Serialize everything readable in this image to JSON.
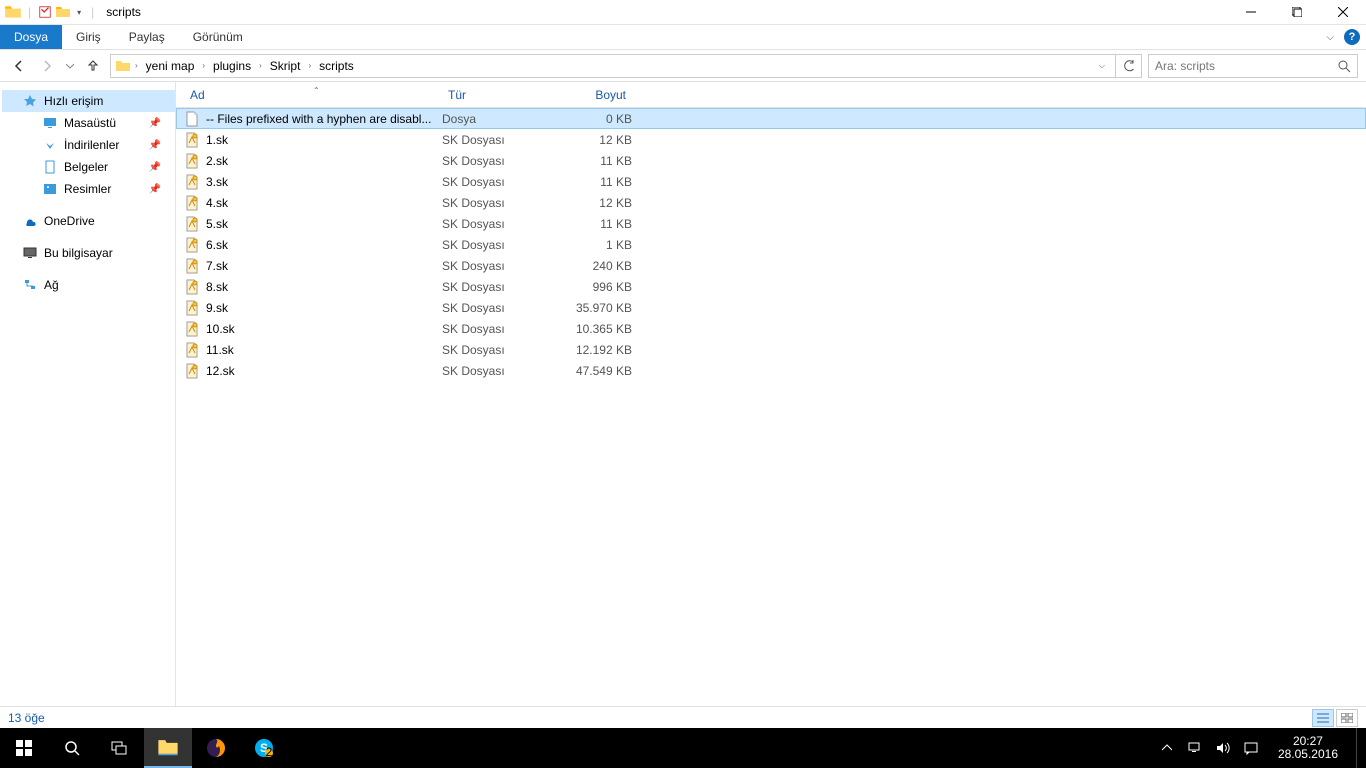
{
  "window": {
    "title": "scripts",
    "controls": {
      "min": "—",
      "max": "▢",
      "close": "✕"
    }
  },
  "ribbon": {
    "file": "Dosya",
    "tabs": [
      "Giriş",
      "Paylaş",
      "Görünüm"
    ]
  },
  "breadcrumb": [
    "yeni map",
    "plugins",
    "Skript",
    "scripts"
  ],
  "search": {
    "placeholder": "Ara: scripts"
  },
  "sidebar": {
    "quick": {
      "label": "Hızlı erişim",
      "items": [
        {
          "label": "Masaüstü",
          "icon": "desktop",
          "pin": true
        },
        {
          "label": "İndirilenler",
          "icon": "download",
          "pin": true
        },
        {
          "label": "Belgeler",
          "icon": "document",
          "pin": true
        },
        {
          "label": "Resimler",
          "icon": "picture",
          "pin": true
        }
      ]
    },
    "onedrive": {
      "label": "OneDrive"
    },
    "thispc": {
      "label": "Bu bilgisayar"
    },
    "network": {
      "label": "Ağ"
    }
  },
  "columns": {
    "name": "Ad",
    "type": "Tür",
    "size": "Boyut"
  },
  "files": [
    {
      "name": "-- Files prefixed with a hyphen are disabl...",
      "type": "Dosya",
      "size": "0 KB",
      "icon": "file",
      "selected": true
    },
    {
      "name": "1.sk",
      "type": "SK Dosyası",
      "size": "12 KB",
      "icon": "sk"
    },
    {
      "name": "2.sk",
      "type": "SK Dosyası",
      "size": "11 KB",
      "icon": "sk"
    },
    {
      "name": "3.sk",
      "type": "SK Dosyası",
      "size": "11 KB",
      "icon": "sk"
    },
    {
      "name": "4.sk",
      "type": "SK Dosyası",
      "size": "12 KB",
      "icon": "sk"
    },
    {
      "name": "5.sk",
      "type": "SK Dosyası",
      "size": "11 KB",
      "icon": "sk"
    },
    {
      "name": "6.sk",
      "type": "SK Dosyası",
      "size": "1 KB",
      "icon": "sk"
    },
    {
      "name": "7.sk",
      "type": "SK Dosyası",
      "size": "240 KB",
      "icon": "sk"
    },
    {
      "name": "8.sk",
      "type": "SK Dosyası",
      "size": "996 KB",
      "icon": "sk"
    },
    {
      "name": "9.sk",
      "type": "SK Dosyası",
      "size": "35.970 KB",
      "icon": "sk"
    },
    {
      "name": "10.sk",
      "type": "SK Dosyası",
      "size": "10.365 KB",
      "icon": "sk"
    },
    {
      "name": "11.sk",
      "type": "SK Dosyası",
      "size": "12.192 KB",
      "icon": "sk"
    },
    {
      "name": "12.sk",
      "type": "SK Dosyası",
      "size": "47.549 KB",
      "icon": "sk"
    }
  ],
  "status": {
    "count": "13 öğe"
  },
  "taskbar": {
    "time": "20:27",
    "date": "28.05.2016"
  }
}
